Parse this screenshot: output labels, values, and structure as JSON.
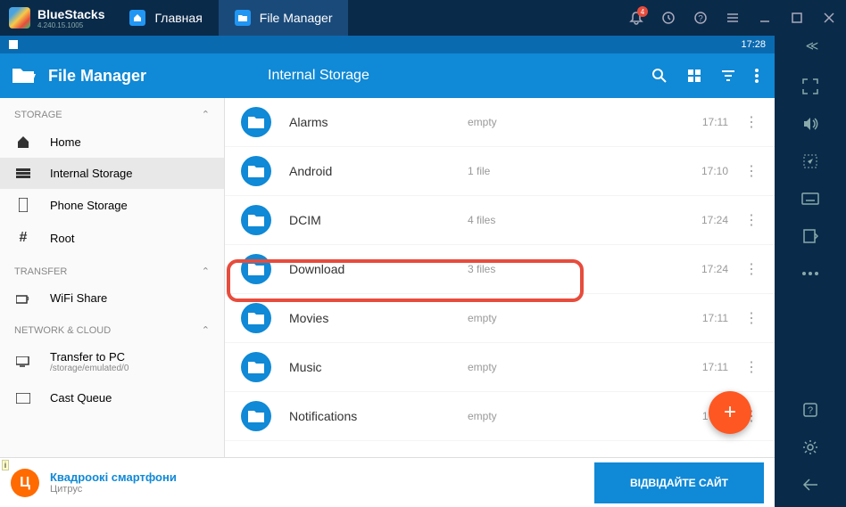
{
  "titlebar": {
    "brand": "BlueStacks",
    "version": "4.240.15.1005",
    "tabs": [
      {
        "label": "Главная",
        "active": false
      },
      {
        "label": "File Manager",
        "active": true
      }
    ],
    "notif_count": "4"
  },
  "statusbar": {
    "time": "17:28"
  },
  "app": {
    "title": "File Manager",
    "header_title": "Internal Storage"
  },
  "sidebar": {
    "sections": {
      "storage": "STORAGE",
      "transfer": "TRANSFER",
      "network": "NETWORK & CLOUD"
    },
    "items": {
      "home": "Home",
      "internal": "Internal Storage",
      "phone": "Phone Storage",
      "root": "Root",
      "wifi": "WiFi Share",
      "transfer_pc": "Transfer to PC",
      "transfer_pc_sub": "/storage/emulated/0",
      "cast": "Cast Queue"
    }
  },
  "folders": [
    {
      "name": "Alarms",
      "info": "empty",
      "time": "17:11"
    },
    {
      "name": "Android",
      "info": "1 file",
      "time": "17:10"
    },
    {
      "name": "DCIM",
      "info": "4 files",
      "time": "17:24"
    },
    {
      "name": "Download",
      "info": "3 files",
      "time": "17:24"
    },
    {
      "name": "Movies",
      "info": "empty",
      "time": "17:11"
    },
    {
      "name": "Music",
      "info": "empty",
      "time": "17:11"
    },
    {
      "name": "Notifications",
      "info": "empty",
      "time": "17:11"
    }
  ],
  "ad": {
    "logo": "Ц",
    "title": "Квадроокі смартфони",
    "sub": "Цитрус",
    "button": "ВІДВІДАЙТЕ САЙТ"
  }
}
